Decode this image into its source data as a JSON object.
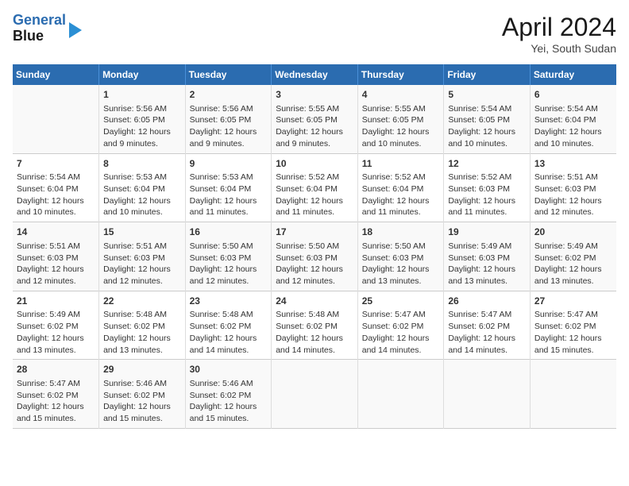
{
  "header": {
    "logo_line1": "General",
    "logo_line2": "Blue",
    "month": "April 2024",
    "location": "Yei, South Sudan"
  },
  "weekdays": [
    "Sunday",
    "Monday",
    "Tuesday",
    "Wednesday",
    "Thursday",
    "Friday",
    "Saturday"
  ],
  "weeks": [
    [
      {
        "day": "",
        "info": ""
      },
      {
        "day": "1",
        "info": "Sunrise: 5:56 AM\nSunset: 6:05 PM\nDaylight: 12 hours and 9 minutes."
      },
      {
        "day": "2",
        "info": "Sunrise: 5:56 AM\nSunset: 6:05 PM\nDaylight: 12 hours and 9 minutes."
      },
      {
        "day": "3",
        "info": "Sunrise: 5:55 AM\nSunset: 6:05 PM\nDaylight: 12 hours and 9 minutes."
      },
      {
        "day": "4",
        "info": "Sunrise: 5:55 AM\nSunset: 6:05 PM\nDaylight: 12 hours and 10 minutes."
      },
      {
        "day": "5",
        "info": "Sunrise: 5:54 AM\nSunset: 6:05 PM\nDaylight: 12 hours and 10 minutes."
      },
      {
        "day": "6",
        "info": "Sunrise: 5:54 AM\nSunset: 6:04 PM\nDaylight: 12 hours and 10 minutes."
      }
    ],
    [
      {
        "day": "7",
        "info": "Sunrise: 5:54 AM\nSunset: 6:04 PM\nDaylight: 12 hours and 10 minutes."
      },
      {
        "day": "8",
        "info": "Sunrise: 5:53 AM\nSunset: 6:04 PM\nDaylight: 12 hours and 10 minutes."
      },
      {
        "day": "9",
        "info": "Sunrise: 5:53 AM\nSunset: 6:04 PM\nDaylight: 12 hours and 11 minutes."
      },
      {
        "day": "10",
        "info": "Sunrise: 5:52 AM\nSunset: 6:04 PM\nDaylight: 12 hours and 11 minutes."
      },
      {
        "day": "11",
        "info": "Sunrise: 5:52 AM\nSunset: 6:04 PM\nDaylight: 12 hours and 11 minutes."
      },
      {
        "day": "12",
        "info": "Sunrise: 5:52 AM\nSunset: 6:03 PM\nDaylight: 12 hours and 11 minutes."
      },
      {
        "day": "13",
        "info": "Sunrise: 5:51 AM\nSunset: 6:03 PM\nDaylight: 12 hours and 12 minutes."
      }
    ],
    [
      {
        "day": "14",
        "info": "Sunrise: 5:51 AM\nSunset: 6:03 PM\nDaylight: 12 hours and 12 minutes."
      },
      {
        "day": "15",
        "info": "Sunrise: 5:51 AM\nSunset: 6:03 PM\nDaylight: 12 hours and 12 minutes."
      },
      {
        "day": "16",
        "info": "Sunrise: 5:50 AM\nSunset: 6:03 PM\nDaylight: 12 hours and 12 minutes."
      },
      {
        "day": "17",
        "info": "Sunrise: 5:50 AM\nSunset: 6:03 PM\nDaylight: 12 hours and 12 minutes."
      },
      {
        "day": "18",
        "info": "Sunrise: 5:50 AM\nSunset: 6:03 PM\nDaylight: 12 hours and 13 minutes."
      },
      {
        "day": "19",
        "info": "Sunrise: 5:49 AM\nSunset: 6:03 PM\nDaylight: 12 hours and 13 minutes."
      },
      {
        "day": "20",
        "info": "Sunrise: 5:49 AM\nSunset: 6:02 PM\nDaylight: 12 hours and 13 minutes."
      }
    ],
    [
      {
        "day": "21",
        "info": "Sunrise: 5:49 AM\nSunset: 6:02 PM\nDaylight: 12 hours and 13 minutes."
      },
      {
        "day": "22",
        "info": "Sunrise: 5:48 AM\nSunset: 6:02 PM\nDaylight: 12 hours and 13 minutes."
      },
      {
        "day": "23",
        "info": "Sunrise: 5:48 AM\nSunset: 6:02 PM\nDaylight: 12 hours and 14 minutes."
      },
      {
        "day": "24",
        "info": "Sunrise: 5:48 AM\nSunset: 6:02 PM\nDaylight: 12 hours and 14 minutes."
      },
      {
        "day": "25",
        "info": "Sunrise: 5:47 AM\nSunset: 6:02 PM\nDaylight: 12 hours and 14 minutes."
      },
      {
        "day": "26",
        "info": "Sunrise: 5:47 AM\nSunset: 6:02 PM\nDaylight: 12 hours and 14 minutes."
      },
      {
        "day": "27",
        "info": "Sunrise: 5:47 AM\nSunset: 6:02 PM\nDaylight: 12 hours and 15 minutes."
      }
    ],
    [
      {
        "day": "28",
        "info": "Sunrise: 5:47 AM\nSunset: 6:02 PM\nDaylight: 12 hours and 15 minutes."
      },
      {
        "day": "29",
        "info": "Sunrise: 5:46 AM\nSunset: 6:02 PM\nDaylight: 12 hours and 15 minutes."
      },
      {
        "day": "30",
        "info": "Sunrise: 5:46 AM\nSunset: 6:02 PM\nDaylight: 12 hours and 15 minutes."
      },
      {
        "day": "",
        "info": ""
      },
      {
        "day": "",
        "info": ""
      },
      {
        "day": "",
        "info": ""
      },
      {
        "day": "",
        "info": ""
      }
    ]
  ]
}
